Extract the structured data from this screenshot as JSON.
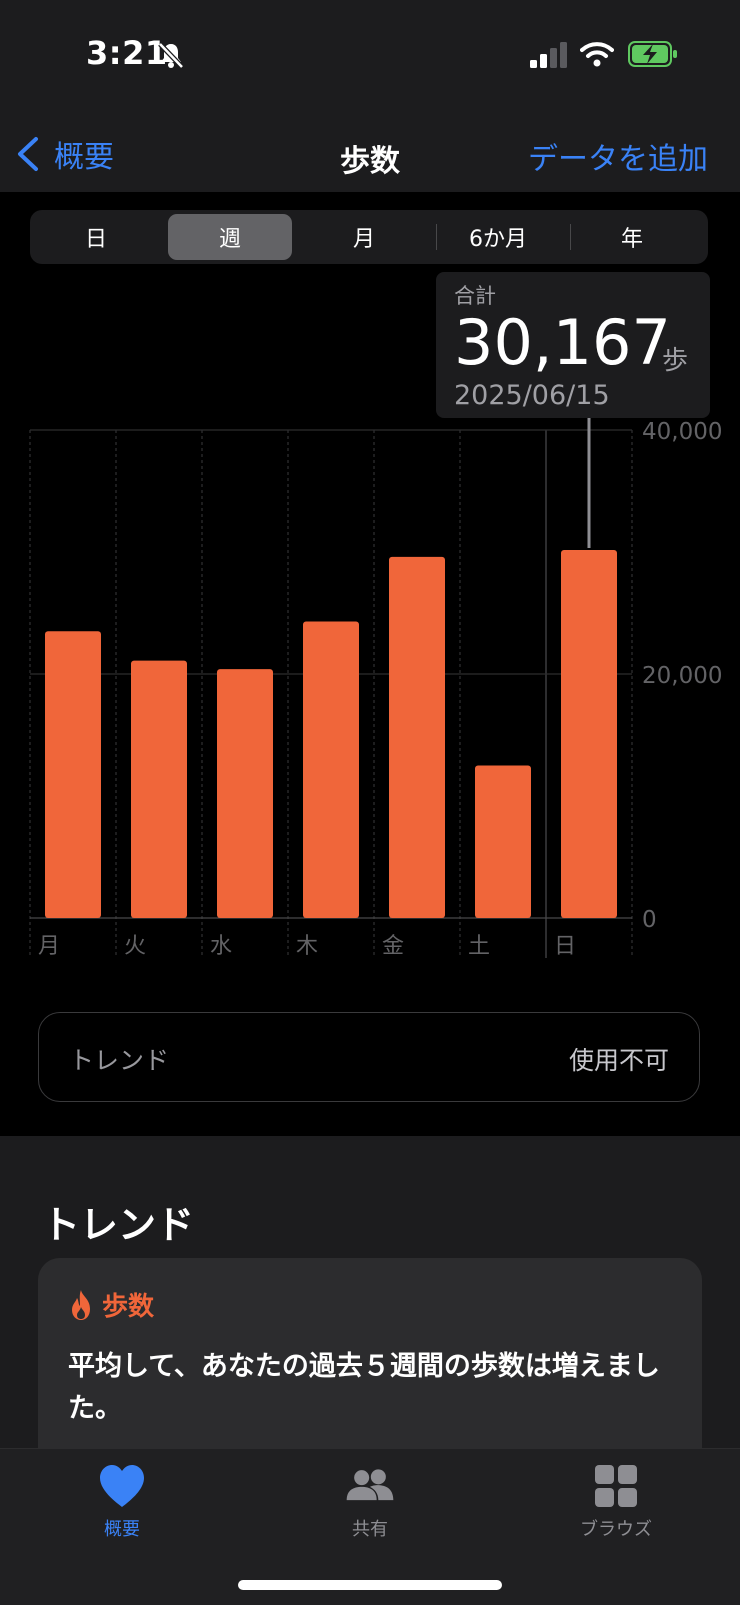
{
  "status_bar": {
    "time": "3:21"
  },
  "nav": {
    "back_label": "概要",
    "title": "歩数",
    "action_label": "データを追加"
  },
  "segments": [
    "日",
    "週",
    "月",
    "6か月",
    "年"
  ],
  "selected_segment": 1,
  "tooltip": {
    "label": "合計",
    "value": "30,167",
    "unit": "歩",
    "date": "2025/06/15"
  },
  "chart_data": {
    "type": "bar",
    "categories": [
      "月",
      "火",
      "水",
      "木",
      "金",
      "土",
      "日"
    ],
    "values": [
      23500,
      21100,
      20400,
      24300,
      29600,
      12500,
      30167
    ],
    "ylim": [
      0,
      40000
    ],
    "y_ticks": [
      40000,
      20000,
      0
    ],
    "y_tick_labels": [
      "40,000",
      "20,000",
      "0"
    ],
    "highlighted_index": 6,
    "bar_color": "#f0663a",
    "grid": true
  },
  "trend_row": {
    "label": "トレンド",
    "value": "使用不可"
  },
  "trends_section": {
    "title": "トレンド",
    "card": {
      "metric": "歩数",
      "text": "平均して、あなたの過去５週間の歩数は増えました。"
    }
  },
  "tab_bar": {
    "tabs": [
      {
        "label": "概要",
        "icon": "heart-icon",
        "active": true
      },
      {
        "label": "共有",
        "icon": "people-icon",
        "active": false
      },
      {
        "label": "ブラウズ",
        "icon": "grid-icon",
        "active": false
      }
    ]
  },
  "colors": {
    "accent": "#3a82f6",
    "bar": "#f0663a",
    "background": "#000000"
  }
}
